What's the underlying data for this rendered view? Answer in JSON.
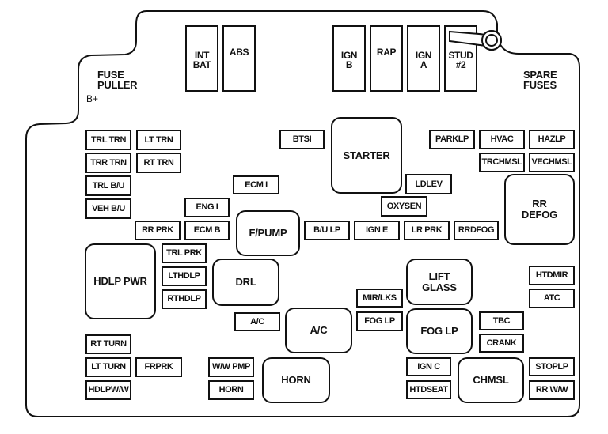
{
  "labels": {
    "fuse_puller": "FUSE\nPULLER",
    "b_plus": "B+",
    "spare_fuses": "SPARE\nFUSES"
  },
  "top_fuses": [
    "INT\nBAT",
    "ABS",
    "IGN\nB",
    "RAP",
    "IGN\nA",
    "STUD\n#2"
  ],
  "small_fuses": {
    "trl_trn": "TRL TRN",
    "lt_trn": "LT TRN",
    "trr_trn": "TRR TRN",
    "rt_trn": "RT TRN",
    "trl_bu": "TRL B/U",
    "veh_bu": "VEH B/U",
    "rr_prk": "RR PRK",
    "eng_i": "ENG I",
    "ecm_b": "ECM B",
    "ecm_i": "ECM I",
    "btsi": "BTSI",
    "trl_prk": "TRL PRK",
    "lthdlp": "LTHDLP",
    "rthdlp": "RTHDLP",
    "ac": "A/C",
    "bu_lp": "B/U LP",
    "ign_e": "IGN E",
    "lr_prk": "LR PRK",
    "rrdfog": "RRDFOG",
    "oxysen": "OXYSEN",
    "ldlev": "LDLEV",
    "parklp": "PARKLP",
    "hvac": "HVAC",
    "hazlp": "HAZLP",
    "trchmsl": "TRCHMSL",
    "vechmsl": "VECHMSL",
    "mir_lks": "MIR/LKS",
    "fog_lp": "FOG LP",
    "htdmir": "HTDMIR",
    "atc": "ATC",
    "tbc": "TBC",
    "crank": "CRANK",
    "ign_c": "IGN C",
    "htdseat": "HTDSEAT",
    "stoplp": "STOPLP",
    "rr_ww": "RR W/W",
    "rt_turn": "RT TURN",
    "lt_turn": "LT TURN",
    "frprk": "FRPRK",
    "hdlpww": "HDLPW/W",
    "ww_pmp": "W/W PMP",
    "horn": "HORN"
  },
  "relays": {
    "starter": "STARTER",
    "rr_defog": "RR\nDEFOG",
    "f_pump": "F/PUMP",
    "hdlp_pwr": "HDLP PWR",
    "drl": "DRL",
    "ac": "A/C",
    "lift_glass": "LIFT\nGLASS",
    "fog_lp": "FOG LP",
    "horn": "HORN",
    "chmsl": "CHMSL"
  }
}
